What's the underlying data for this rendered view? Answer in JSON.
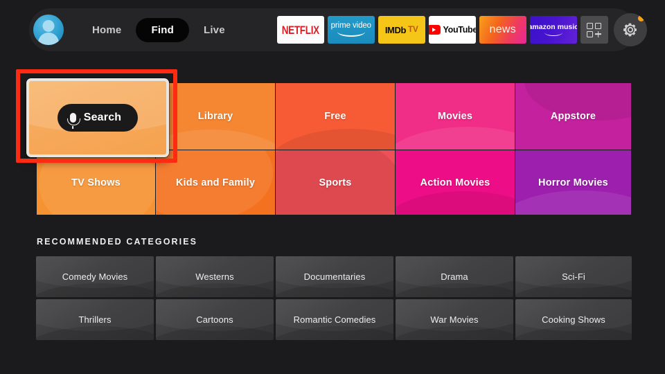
{
  "header": {
    "avatar_name": "profile-avatar",
    "nav": [
      {
        "label": "Home",
        "active": false
      },
      {
        "label": "Find",
        "active": true
      },
      {
        "label": "Live",
        "active": false
      }
    ],
    "apps": [
      {
        "name": "netflix",
        "label": "NETFLIX"
      },
      {
        "name": "prime-video",
        "label": "prime video"
      },
      {
        "name": "imdb-tv",
        "label": "IMDb",
        "label2": "TV"
      },
      {
        "name": "youtube",
        "label": "YouTube"
      },
      {
        "name": "news",
        "label": "news"
      },
      {
        "name": "amazon-music",
        "label": "amazon",
        "label2": "music"
      }
    ],
    "apps_grid_icon": "grid-plus-icon",
    "settings_icon": "gear-icon",
    "settings_badge": "notification-dot"
  },
  "search_tile": {
    "label": "Search",
    "icon": "microphone-icon",
    "focused": true,
    "highlight_color": "#fc2b11"
  },
  "category_tiles": [
    {
      "label": "TV Shows",
      "color": "#f79232",
      "row": 1,
      "col": 0
    },
    {
      "label": "Library",
      "color": "#f58733",
      "row": 0,
      "col": 1
    },
    {
      "label": "Kids and Family",
      "color": "#f4711f",
      "row": 1,
      "col": 1
    },
    {
      "label": "Free",
      "color": "#f65b36",
      "row": 0,
      "col": 2
    },
    {
      "label": "Sports",
      "color": "#ef4f57",
      "row": 1,
      "col": 2
    },
    {
      "label": "Movies",
      "color": "#f02d87",
      "row": 0,
      "col": 3
    },
    {
      "label": "Action Movies",
      "color": "#ed0d86",
      "row": 1,
      "col": 3
    },
    {
      "label": "Appstore",
      "color": "#c4219f",
      "row": 0,
      "col": 4
    },
    {
      "label": "Horror Movies",
      "color": "#9c1fad",
      "row": 1,
      "col": 4
    }
  ],
  "recommended": {
    "title": "RECOMMENDED CATEGORIES",
    "tiles": [
      "Comedy Movies",
      "Westerns",
      "Documentaries",
      "Drama",
      "Sci-Fi",
      "Thrillers",
      "Cartoons",
      "Romantic Comedies",
      "War Movies",
      "Cooking Shows"
    ]
  },
  "colors": {
    "background": "#1b1b1d",
    "topbar": "#252527",
    "accent_highlight": "#fc2b11",
    "search_tile": "#f6a95a"
  }
}
